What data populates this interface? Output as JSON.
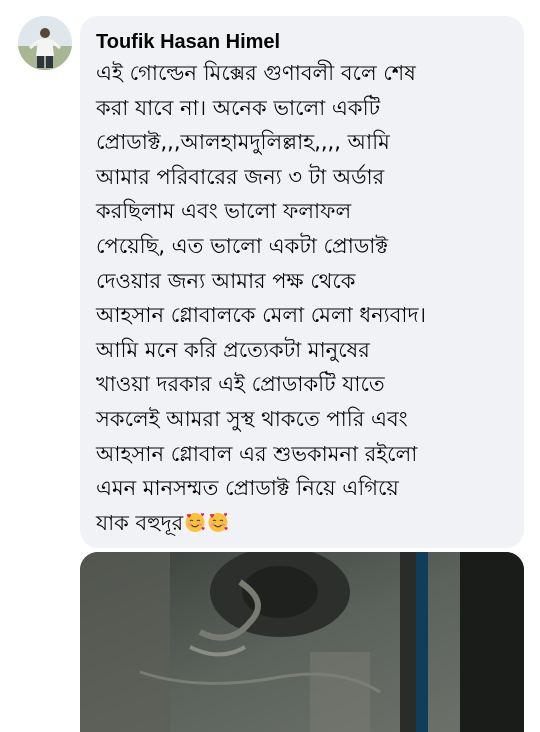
{
  "comment": {
    "author": "Toufik Hasan Himel",
    "text": "এই গোল্ডেন মিক্সের গুণাবলী বলে শেষ\nকরা যাবে না। অনেক ভালো একটি\nপ্রোডাক্ট,,,আলহামদুলিল্লাহ,,,, আমি\nআমার পরিবারের জন্য ৩ টা অর্ডার\nকরছিলাম এবং ভালো ফলাফল\nপেয়েছি, এত ভালো একটা প্রোডাক্ট\nদেওয়ার জন্য আমার পক্ষ থেকে\nআহসান গ্লোবালকে মেলা মেলা ধন্যবাদ।\nআমি মনে করি প্রত্যেকটা মানুষের\nখাওয়া দরকার এই প্রোডাকটি যাতে\nসকলেই আমরা সুস্থ থাকতে পারি এবং\nআহসান গ্লোবাল এর শুভকামনা রইলো\nএমন মানসম্মত  প্রোডাক্ট নিয়ে এগিয়ে\nযাক বহুদূর",
    "emojis": [
      "smiling-face-with-hearts",
      "smiling-face-with-hearts"
    ]
  },
  "colors": {
    "bubble_bg": "#f0f2f5",
    "text": "#050505"
  }
}
